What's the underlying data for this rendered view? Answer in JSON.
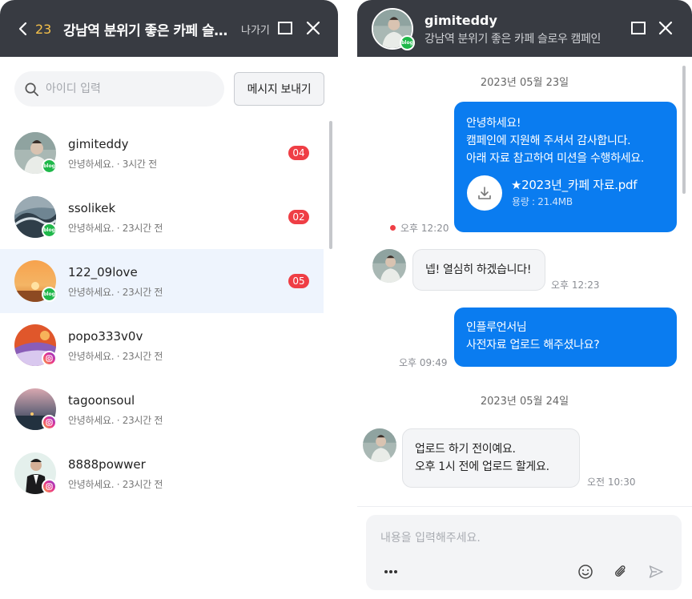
{
  "left": {
    "count": "23",
    "title": "강남역 분위기 좋은 카페 슬로...",
    "exit_label": "나가기",
    "search_placeholder": "아이디 입력",
    "send_message_label": "메시지 보내기",
    "conversations": [
      {
        "name": "gimiteddy",
        "preview": "안녕하세요.",
        "time": "· 3시간 전",
        "unread": "04",
        "platform": "blog"
      },
      {
        "name": "ssolikek",
        "preview": "안녕하세요.",
        "time": "· 23시간 전",
        "unread": "02",
        "platform": "blog"
      },
      {
        "name": "122_09love",
        "preview": "안녕하세요.",
        "time": "· 23시간 전",
        "unread": "05",
        "platform": "blog"
      },
      {
        "name": "popo333v0v",
        "preview": "안녕하세요.",
        "time": "· 23시간 전",
        "unread": "",
        "platform": "instagram"
      },
      {
        "name": "tagoonsoul",
        "preview": "안녕하세요.",
        "time": "· 23시간 전",
        "unread": "",
        "platform": "instagram"
      },
      {
        "name": "8888powwer",
        "preview": "안녕하세요.",
        "time": "· 23시간 전",
        "unread": "",
        "platform": "instagram"
      }
    ]
  },
  "right": {
    "name": "gimiteddy",
    "campaign": "강남역 분위기 좋은 카페 슬로우 캠페인",
    "blog_badge": "blog",
    "date1": "2023년 05월 23일",
    "msg1_line1": "안녕하세요!",
    "msg1_line2": "캠페인에 지원해 주셔서 감사합니다.",
    "msg1_line3": "아래 자료 참고하여 미션을 수행하세요.",
    "file_name": "★2023년_카페 자료.pdf",
    "file_size": "용량 : 21.4MB",
    "msg1_time": "오후 12:20",
    "msg2_text": "넵! 열심히 하겠습니다!",
    "msg2_time": "오후 12:23",
    "msg3_line1": "인플루언서님",
    "msg3_line2": "사전자료 업로드 해주셨나요?",
    "msg3_time": "오후 09:49",
    "date2": "2023년 05월 24일",
    "msg4_line1": "업로드 하기 전이예요.",
    "msg4_line2": "오후 1시 전에 업로드 할게요.",
    "msg4_time": "오전 10:30",
    "input_placeholder": "내용을 입력해주세요."
  },
  "colors": {
    "header": "#383b42",
    "accent": "#0a7cf0",
    "badge_red": "#ef3e45",
    "count_yellow": "#f5c04a",
    "blog_green": "#1fb84a"
  },
  "icons": [
    "chevron-left-icon",
    "maximize-icon",
    "close-icon",
    "search-icon",
    "download-icon",
    "more-icon",
    "emoji-icon",
    "attach-icon",
    "send-icon"
  ]
}
